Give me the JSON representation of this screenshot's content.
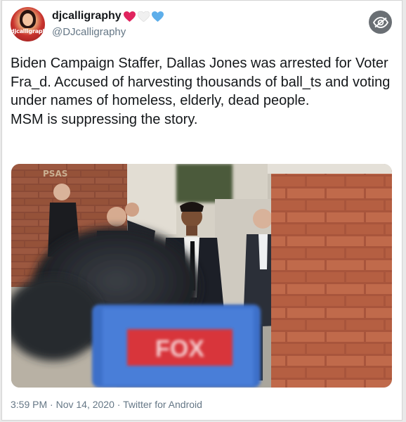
{
  "tweet": {
    "display_name": "djcalligraphy",
    "handle": "@DJcalligraphy",
    "avatar_text": "djcalligraphy",
    "name_hearts": [
      {
        "icon": "red-heart-icon",
        "color": "#e0245e"
      },
      {
        "icon": "white-heart-icon",
        "color": "#f2f2f2"
      },
      {
        "icon": "blue-heart-icon",
        "color": "#5daeea"
      }
    ],
    "text_lines": [
      "Biden Campaign Staffer, Dallas Jones was arrested for Voter Fra_d. Accused of harvesting thousands of ball_ts and voting under names of homeless, elderly, dead people.",
      "MSM is suppressing the story."
    ],
    "media": {
      "watermark": "PSAS",
      "mic_flag_text": "FOX"
    },
    "time": "3:59 PM",
    "separator": " · ",
    "date": "Nov 14, 2020",
    "source": "Twitter for Android"
  },
  "colors": {
    "text": "#14171a",
    "muted": "#657786",
    "eye_button": "#6a6f74"
  }
}
